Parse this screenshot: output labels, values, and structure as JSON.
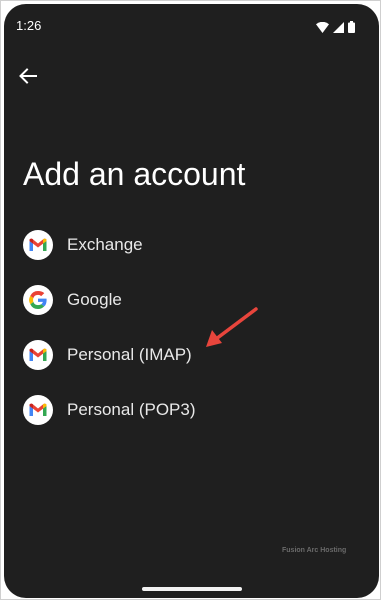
{
  "status_bar": {
    "time": "1:26",
    "icons": [
      "wifi-icon",
      "cellular-signal-icon",
      "battery-icon"
    ]
  },
  "header": {
    "back_icon": "arrow-back-icon"
  },
  "page": {
    "title": "Add an account"
  },
  "accounts": [
    {
      "label": "Exchange",
      "icon": "gmail-icon"
    },
    {
      "label": "Google",
      "icon": "google-icon"
    },
    {
      "label": "Personal (IMAP)",
      "icon": "gmail-icon"
    },
    {
      "label": "Personal (POP3)",
      "icon": "gmail-icon"
    }
  ],
  "annotation": {
    "arrow_color": "#e8453c",
    "points_to": "Personal (IMAP)"
  },
  "watermark": "Fusion Arc Hosting",
  "colors": {
    "background": "#1f1f1f",
    "text": "#ffffff",
    "gmail_red": "#ea4335",
    "gmail_blue": "#4285f4",
    "gmail_green": "#34a853",
    "gmail_yellow": "#fbbc04"
  }
}
